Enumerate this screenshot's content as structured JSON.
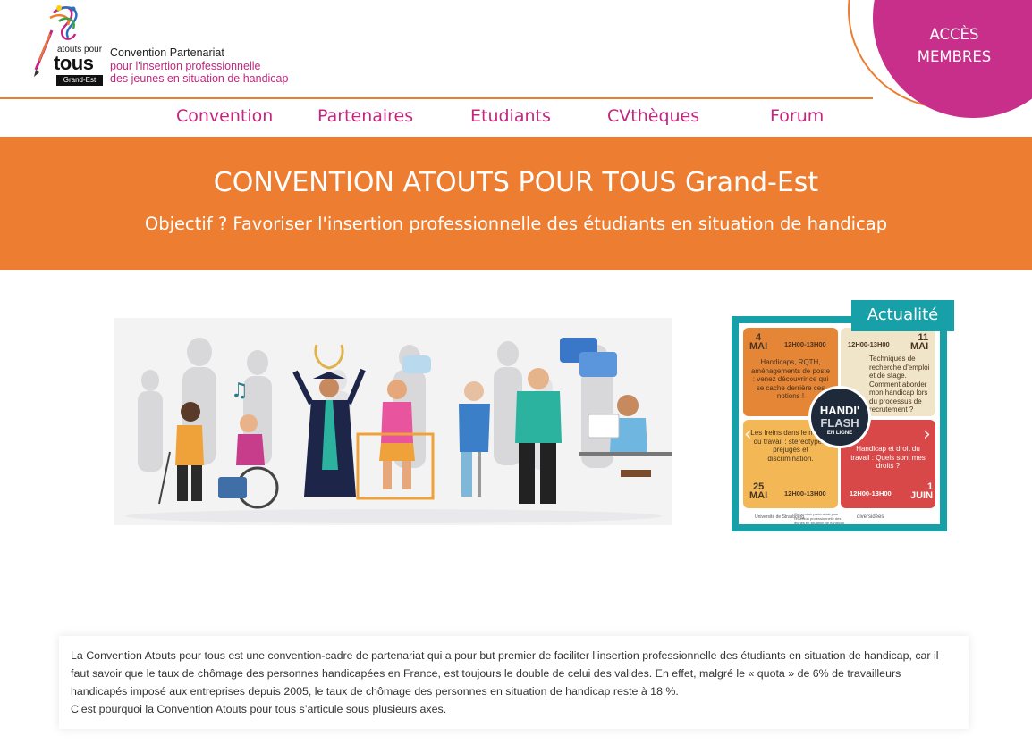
{
  "logo": {
    "small": "atouts pour",
    "big": "tous",
    "badge": "Grand-Est",
    "line1": "Convention Partenariat",
    "line2": "pour l'insertion professionnelle",
    "line3": "des jeunes en situation de handicap"
  },
  "acces": {
    "line1": "ACCÈS",
    "line2": "MEMBRES"
  },
  "nav": [
    "Convention",
    "Partenaires",
    "Etudiants",
    "CVthèques",
    "Forum"
  ],
  "hero": {
    "title": "CONVENTION ATOUTS POUR TOUS Grand-Est",
    "subtitle": "Objectif ? Favoriser l'insertion professionnelle des étudiants en situation de handicap"
  },
  "news": {
    "label": "Actualité",
    "poster": {
      "q1": {
        "day": "4",
        "month": "MAI",
        "time": "12H00-13H00",
        "text": "Handicaps, RQTH, aménagements de poste : venez découvrir ce qui se cache derrière ces notions !"
      },
      "q2": {
        "day": "11",
        "month": "MAI",
        "time": "12H00-13H00",
        "items": [
          "Techniques de recherche d'emploi et de stage.",
          "Comment aborder mon handicap lors du processus de recrutement ?"
        ]
      },
      "q3": {
        "day": "25",
        "month": "MAI",
        "time": "12H00-13H00",
        "text": "Les freins dans le monde du travail : stéréotypes, préjugés et discrimination."
      },
      "q4": {
        "day": "1",
        "month": "JUIN",
        "time": "12H00-13H00",
        "text": "Handicap et droit du travail : Quels sont mes droits ?"
      },
      "badge": {
        "line1": "HANDI'",
        "line2": "FLASH",
        "line3": "EN LIGNE"
      },
      "footer": [
        "Université de Strasbourg",
        "Convention partenariat pour l'insertion professionnelle des jeunes en situation de handicap",
        "diversidées"
      ]
    },
    "prev": "‹",
    "next": "›"
  },
  "intro": {
    "p1": "La Convention Atouts pour tous est une convention-cadre de partenariat qui a pour but premier de faciliter l’insertion professionnelle des étudiants en situation de handicap, car il faut savoir que le taux de chômage des personnes handicapées en France, est toujours le double de celui des valides. En effet, malgré le « quota » de 6% de travailleurs handicapés imposé aux entreprises depuis 2005, le taux de chômage des personnes en situation de handicap reste à 18 %.",
    "p2": "C’est pourquoi la Convention Atouts pour tous s’articule sous plusieurs axes."
  },
  "colors": {
    "orange": "#ed7d31",
    "magenta": "#c2267e",
    "teal": "#17a0a7"
  }
}
